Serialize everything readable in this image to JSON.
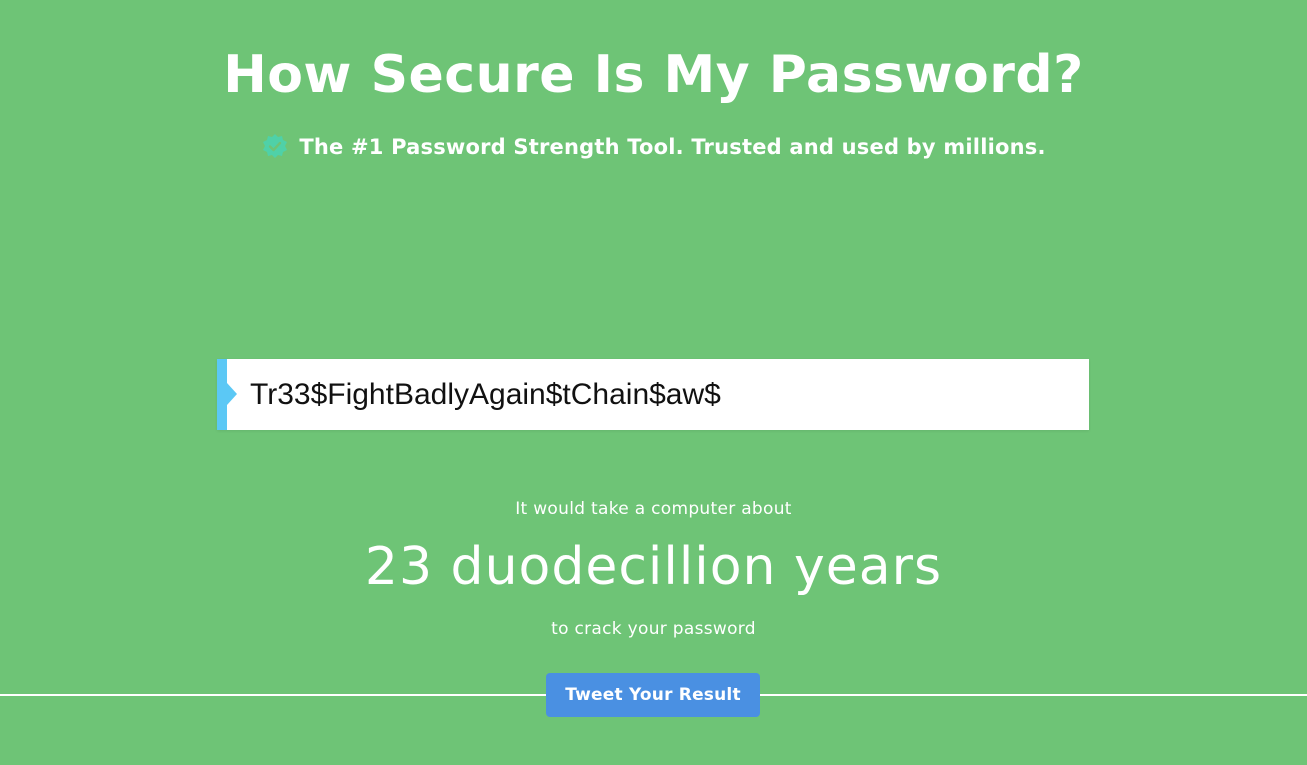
{
  "header": {
    "title": "How Secure Is My Password?",
    "tagline": "The #1 Password Strength Tool. Trusted and used by millions.",
    "tagline_icon": "verified-check-icon"
  },
  "password_field": {
    "value": "Tr33$FightBadlyAgain$tChain$aw$",
    "accent_color": "#5bc8f5"
  },
  "result": {
    "intro": "It would take a computer about",
    "time": "23 duodecillion years",
    "outro": "to crack your password"
  },
  "actions": {
    "tweet_label": "Tweet Your Result"
  },
  "colors": {
    "background": "#6ec476",
    "badge": "#4fd1a8",
    "button": "#4a90e2"
  }
}
